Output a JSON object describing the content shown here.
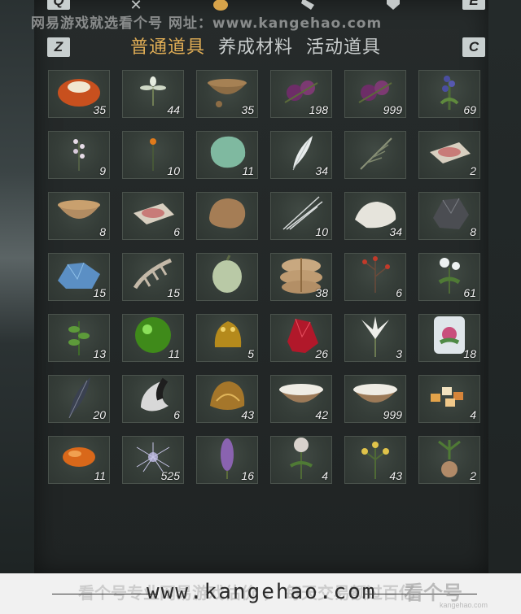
{
  "topbar": {
    "key_q": "Q",
    "key_e": "E",
    "key_z": "Z",
    "key_c": "C",
    "watermark": "网易游戏就选看个号   网址：www.kangehao.com"
  },
  "tabs": [
    {
      "label": "普通道具",
      "active": true
    },
    {
      "label": "养成材料",
      "active": false
    },
    {
      "label": "活动道具",
      "active": false
    }
  ],
  "items": [
    {
      "icon": "red-stone-icon",
      "count": "35"
    },
    {
      "icon": "white-herb-icon",
      "count": "44"
    },
    {
      "icon": "herb-bowl-icon",
      "count": "35"
    },
    {
      "icon": "purple-flower-icon",
      "count": "198"
    },
    {
      "icon": "purple-flower-icon",
      "count": "999"
    },
    {
      "icon": "blue-flower-icon",
      "count": "69"
    },
    {
      "icon": "small-white-flower-icon",
      "count": "9"
    },
    {
      "icon": "orange-flower-icon",
      "count": "10"
    },
    {
      "icon": "jade-stone-icon",
      "count": "11"
    },
    {
      "icon": "white-feather-icon",
      "count": "34"
    },
    {
      "icon": "grass-sprig-icon",
      "count": ""
    },
    {
      "icon": "raw-meat-icon",
      "count": "2"
    },
    {
      "icon": "clay-bowl-icon",
      "count": "8"
    },
    {
      "icon": "raw-meat-icon",
      "count": "6"
    },
    {
      "icon": "brown-fur-icon",
      "count": ""
    },
    {
      "icon": "quill-bundle-icon",
      "count": "10"
    },
    {
      "icon": "white-fur-icon",
      "count": "34"
    },
    {
      "icon": "iron-ore-icon",
      "count": "8"
    },
    {
      "icon": "blue-crystal-icon",
      "count": "15"
    },
    {
      "icon": "bone-icon",
      "count": "15"
    },
    {
      "icon": "gourd-icon",
      "count": ""
    },
    {
      "icon": "rice-bundle-icon",
      "count": "38"
    },
    {
      "icon": "red-berry-branch-icon",
      "count": "6"
    },
    {
      "icon": "white-flower-bush-icon",
      "count": "61"
    },
    {
      "icon": "green-herb-icon",
      "count": "13"
    },
    {
      "icon": "green-orb-icon",
      "count": "11"
    },
    {
      "icon": "gold-toad-icon",
      "count": "5"
    },
    {
      "icon": "red-ore-icon",
      "count": "26"
    },
    {
      "icon": "lily-icon",
      "count": "3"
    },
    {
      "icon": "ice-flower-icon",
      "count": "18"
    },
    {
      "icon": "black-feather-icon",
      "count": "20"
    },
    {
      "icon": "fox-tail-icon",
      "count": "6"
    },
    {
      "icon": "gold-shell-icon",
      "count": "43"
    },
    {
      "icon": "milk-bowl-icon",
      "count": "42"
    },
    {
      "icon": "milk-bowl-icon",
      "count": "999"
    },
    {
      "icon": "candy-pile-icon",
      "count": "4"
    },
    {
      "icon": "amber-stone-icon",
      "count": "11"
    },
    {
      "icon": "spider-flower-icon",
      "count": "525"
    },
    {
      "icon": "lavender-icon",
      "count": "16"
    },
    {
      "icon": "white-chrysanthemum-icon",
      "count": "4"
    },
    {
      "icon": "yellow-flower-icon",
      "count": "43"
    },
    {
      "icon": "root-plant-icon",
      "count": "2"
    }
  ],
  "footer": {
    "url": "www.kangehao.com",
    "watermark": "看个号专业网易游戏估价 ， 每天交易额过百亿",
    "brand": "看个号",
    "brand_sub": "kangehao.com"
  },
  "colors": {
    "tab_active": "#e0ad55",
    "tab_inactive": "#c9cdcd",
    "slot_bg": "#38403a"
  }
}
